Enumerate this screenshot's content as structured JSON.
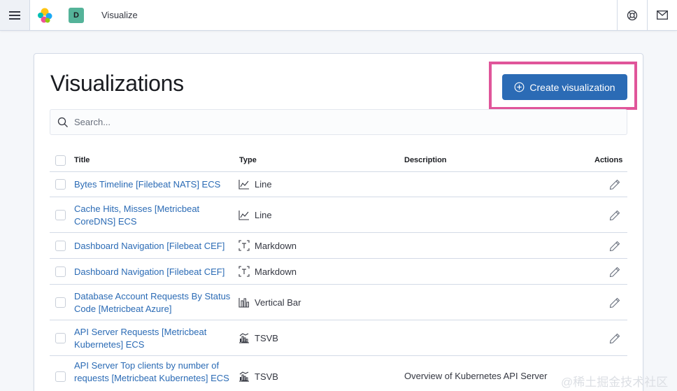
{
  "header": {
    "space_initial": "D",
    "app_title": "Visualize",
    "icons": [
      "menu-icon",
      "elastic-logo",
      "help-icon",
      "mail-icon"
    ]
  },
  "page": {
    "title": "Visualizations",
    "create_button_label": "Create visualization"
  },
  "search": {
    "placeholder": "Search..."
  },
  "table": {
    "headers": {
      "title": "Title",
      "type": "Type",
      "description": "Description",
      "actions": "Actions"
    },
    "rows": [
      {
        "title": "Bytes Timeline [Filebeat NATS] ECS",
        "type": "Line",
        "type_icon": "line-chart-icon",
        "description": ""
      },
      {
        "title": "Cache Hits, Misses [Metricbeat CoreDNS] ECS",
        "type": "Line",
        "type_icon": "line-chart-icon",
        "description": ""
      },
      {
        "title": "Dashboard Navigation [Filebeat CEF]",
        "type": "Markdown",
        "type_icon": "markdown-icon",
        "description": ""
      },
      {
        "title": "Dashboard Navigation [Filebeat CEF]",
        "type": "Markdown",
        "type_icon": "markdown-icon",
        "description": ""
      },
      {
        "title": "Database Account Requests By Status Code [Metricbeat Azure]",
        "type": "Vertical Bar",
        "type_icon": "bar-chart-icon",
        "description": ""
      },
      {
        "title": "API Server Requests [Metricbeat Kubernetes] ECS",
        "type": "TSVB",
        "type_icon": "tsvb-icon",
        "description": ""
      },
      {
        "title": "API Server Top clients by number of requests [Metricbeat Kubernetes] ECS",
        "type": "TSVB",
        "type_icon": "tsvb-icon",
        "description": "Overview of Kubernetes API Server"
      }
    ]
  },
  "watermark": "@稀土掘金技术社区",
  "colors": {
    "primary": "#2b6bb5",
    "highlight": "#e0559a",
    "space_badge": "#54b399"
  }
}
